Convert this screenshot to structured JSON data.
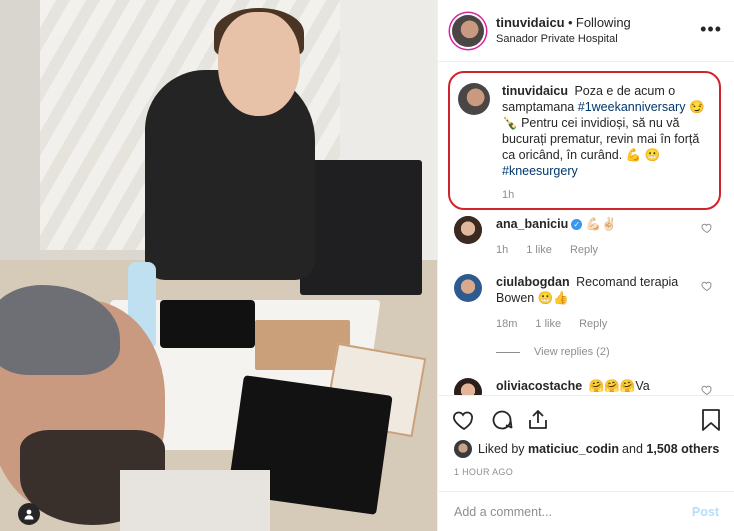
{
  "header": {
    "username": "tinuvidaicu",
    "separator": "•",
    "follow_status": "Following",
    "location": "Sanador Private Hospital",
    "more_icon": "more-horizontal-icon"
  },
  "caption": {
    "username": "tinuvidaicu",
    "text_1": "Poza e de acum o samptamana",
    "hashtag_1": "#1weekanniversary",
    "emoji_1": "😏",
    "emoji_2": "🍾",
    "text_2": "Pentru cei invidioși, să nu vă bucurați prematur, revin mai în forță ca oricând, în curând.",
    "emoji_3": "💪",
    "emoji_4": "😬",
    "hashtag_2": "#kneesurgery",
    "time": "1h"
  },
  "comments": [
    {
      "username": "ana_baniciu",
      "verified": true,
      "text": "💪🏻✌🏻",
      "time": "1h",
      "likes": "1 like",
      "reply": "Reply"
    },
    {
      "username": "ciulabogdan",
      "text": "Recomand terapia Bowen 😬👍",
      "time": "18m",
      "likes": "1 like",
      "reply": "Reply",
      "view_replies": "View replies (2)"
    },
    {
      "username": "oliviacostache",
      "text": "🤗🤗🤗Va astept la bazin!!!",
      "time": "",
      "likes": "",
      "reply": ""
    }
  ],
  "likes": {
    "liked_by_prefix": "Liked by",
    "liker": "maticiuc_codin",
    "and": "and",
    "others": "1,508 others"
  },
  "time_ago": "1 HOUR AGO",
  "add_comment": {
    "placeholder": "Add a comment...",
    "post_label": "Post"
  },
  "colors": {
    "caption_highlight": "#d1232b",
    "link": "#00376b",
    "muted": "#8e8e8e",
    "post_disabled": "#b2dffc",
    "verified": "#3897f0"
  },
  "icons": [
    "heart-icon",
    "comment-icon",
    "share-icon",
    "bookmark-icon",
    "user-tag-icon"
  ]
}
